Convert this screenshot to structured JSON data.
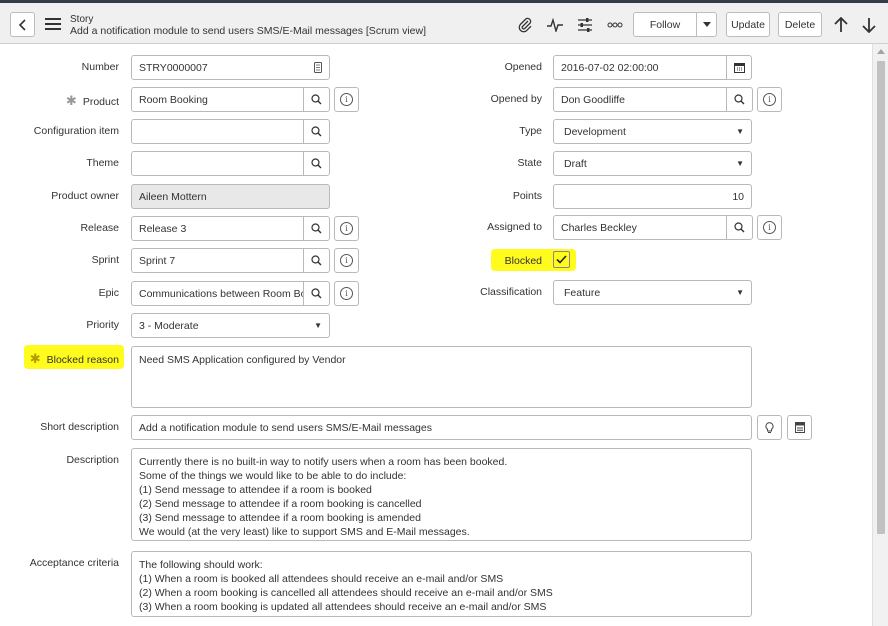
{
  "header": {
    "record_type": "Story",
    "record_title": "Add a notification module to send users SMS/E-Mail messages [Scrum view]",
    "follow_label": "Follow",
    "update_label": "Update",
    "delete_label": "Delete",
    "icons": [
      "back-icon",
      "hamburger-menu-icon",
      "paperclip-icon",
      "activity-icon",
      "settings-sliders-icon",
      "more-options-icon",
      "caret-down-icon",
      "arrow-up-icon",
      "arrow-down-icon"
    ]
  },
  "form": {
    "number": {
      "label": "Number",
      "value": "STRY0000007"
    },
    "product": {
      "label": "Product",
      "value": "Room Booking",
      "required": true
    },
    "configuration_item": {
      "label": "Configuration item",
      "value": ""
    },
    "theme": {
      "label": "Theme",
      "value": ""
    },
    "product_owner": {
      "label": "Product owner",
      "value": "Aileen Mottern"
    },
    "release": {
      "label": "Release",
      "value": "Release 3"
    },
    "sprint": {
      "label": "Sprint",
      "value": "Sprint 7"
    },
    "epic": {
      "label": "Epic",
      "value": "Communications between Room Bo"
    },
    "priority": {
      "label": "Priority",
      "value": "3 - Moderate"
    },
    "opened": {
      "label": "Opened",
      "value": "2016-07-02 02:00:00"
    },
    "opened_by": {
      "label": "Opened by",
      "value": "Don Goodliffe"
    },
    "type": {
      "label": "Type",
      "value": "Development"
    },
    "state": {
      "label": "State",
      "value": "Draft"
    },
    "points": {
      "label": "Points",
      "value": "10"
    },
    "assigned_to": {
      "label": "Assigned to",
      "value": "Charles Beckley"
    },
    "blocked": {
      "label": "Blocked",
      "checked": true
    },
    "classification": {
      "label": "Classification",
      "value": "Feature"
    },
    "blocked_reason": {
      "label": "Blocked reason",
      "value": "Need SMS Application configured by Vendor",
      "required": true
    },
    "short_description": {
      "label": "Short description",
      "value": "Add a notification module to send users SMS/E-Mail messages"
    },
    "description": {
      "label": "Description",
      "lines": [
        "Currently there is no built-in way to notify users when a room has been booked.",
        "Some of the things we would like to be able to do include:",
        "(1) Send message to attendee if a room is booked",
        "(2) Send message to attendee if a room booking is cancelled",
        "(3) Send message to attendee if a room booking is amended",
        "We would (at the very least) like to support SMS and E-Mail messages."
      ]
    },
    "acceptance_criteria": {
      "label": "Acceptance criteria",
      "lines": [
        "The following should work:",
        "(1) When a room is booked all attendees should receive an e-mail and/or SMS",
        "(2) When a room booking is cancelled all attendees should receive an e-mail and/or SMS",
        "(3) When a room booking is updated all attendees should receive an e-mail and/or SMS"
      ]
    }
  },
  "colors": {
    "highlight": "#fffb1d",
    "topbar_border": "#343d47",
    "readonly_bg": "#e8e8e8"
  }
}
